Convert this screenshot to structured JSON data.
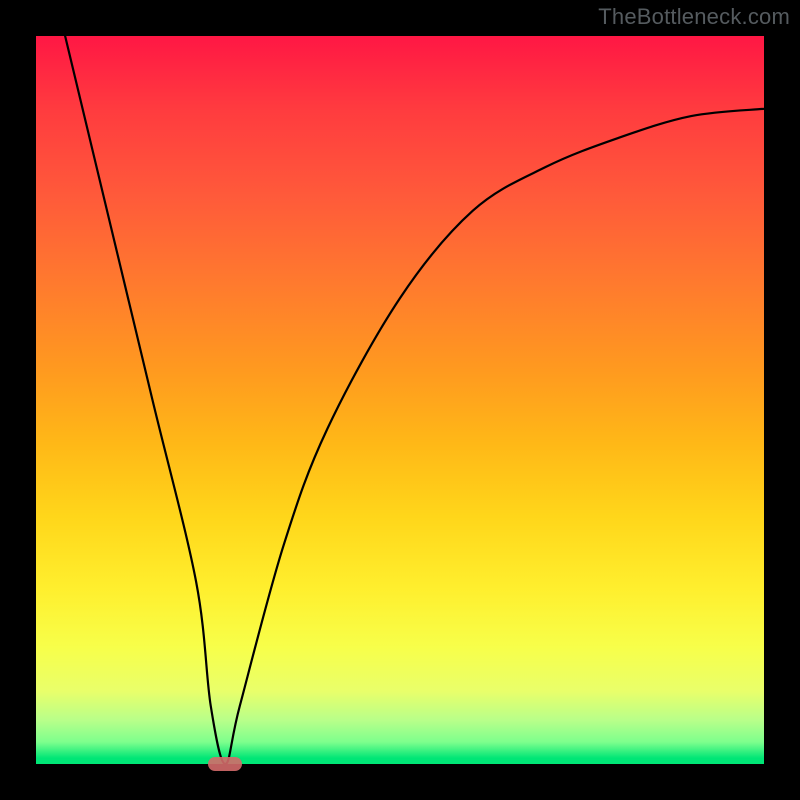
{
  "watermark": {
    "text": "TheBottleneck.com"
  },
  "chart_data": {
    "type": "line",
    "title": "",
    "xlabel": "",
    "ylabel": "",
    "xlim": [
      0,
      100
    ],
    "ylim": [
      0,
      100
    ],
    "grid": false,
    "legend": false,
    "background_gradient": [
      "#ff1744",
      "#ff9a1f",
      "#ffef2e",
      "#00e676"
    ],
    "series": [
      {
        "name": "bottleneck-curve",
        "stroke": "#000000",
        "x": [
          4,
          10,
          16,
          22,
          24,
          26,
          28,
          34,
          40,
          50,
          60,
          70,
          80,
          90,
          100
        ],
        "y": [
          100,
          75,
          50,
          25,
          8,
          0,
          8,
          30,
          46,
          64,
          76,
          82,
          86,
          89,
          90
        ]
      }
    ],
    "markers": [
      {
        "name": "optimal-point",
        "x": 26,
        "y": 0,
        "shape": "pill",
        "color": "#d46a6a"
      }
    ]
  }
}
